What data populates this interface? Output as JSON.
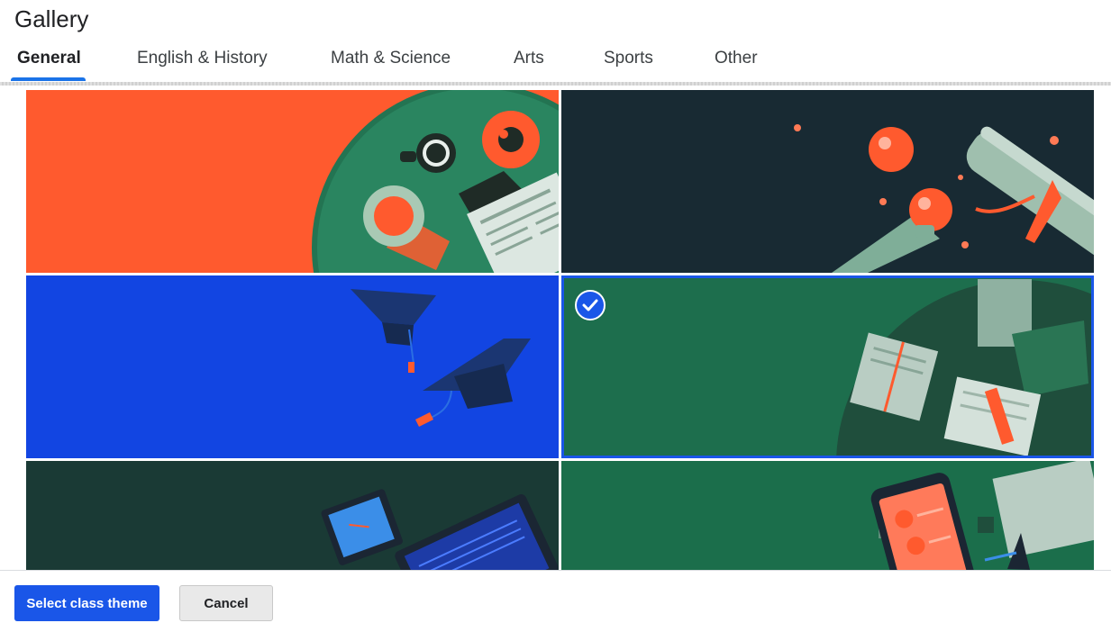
{
  "dialog": {
    "title": "Gallery"
  },
  "tabs": [
    {
      "label": "General",
      "selected": true
    },
    {
      "label": "English & History",
      "selected": false
    },
    {
      "label": "Math & Science",
      "selected": false
    },
    {
      "label": "Arts",
      "selected": false
    },
    {
      "label": "Sports",
      "selected": false
    },
    {
      "label": "Other",
      "selected": false
    }
  ],
  "themes": [
    {
      "name": "coffee-and-newspaper",
      "background": "#ff5a2e",
      "selected": false
    },
    {
      "name": "diploma-and-lanterns",
      "background": "#182a33",
      "selected": false
    },
    {
      "name": "graduation-caps",
      "background": "#1245e2",
      "selected": false
    },
    {
      "name": "books-on-table",
      "background": "#1d6e4d",
      "selected": true
    },
    {
      "name": "laptop-and-notebook",
      "background": "#1a3a35",
      "selected": false
    },
    {
      "name": "phone-and-papers",
      "background": "#1b6e4b",
      "selected": false
    }
  ],
  "colors": {
    "accent": "#1a56e8",
    "tab_indicator": "#1a73e8"
  },
  "footer": {
    "primary_label": "Select class theme",
    "secondary_label": "Cancel"
  }
}
